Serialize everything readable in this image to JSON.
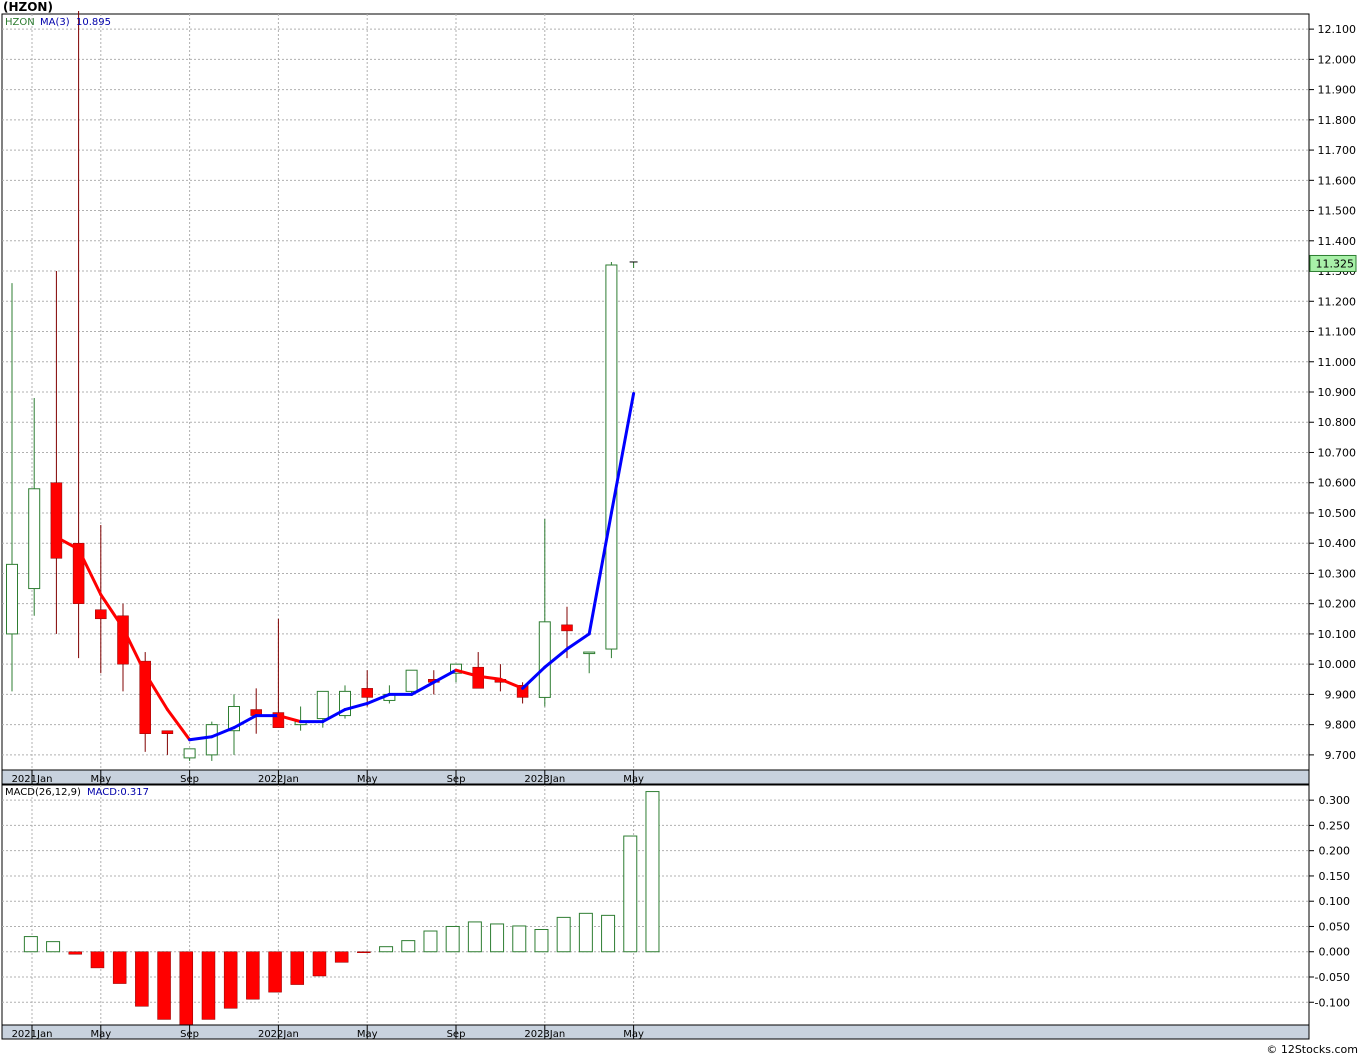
{
  "title": "(HZON)",
  "footer": "© 12Stocks.com",
  "colors": {
    "up": "#2e7d32",
    "down": "#ff0000",
    "ma_down": "#ff0000",
    "ma_up": "#0000ff",
    "axis_band": "#c8d2de",
    "grid": "#b0b0b0",
    "last_price_box": "#a8f0a8"
  },
  "x_axis": {
    "labels": [
      "2021Jan",
      "May",
      "Sep",
      "2022Jan",
      "May",
      "Sep",
      "2023Jan",
      "May"
    ],
    "label_month_index": [
      0,
      4,
      8,
      12,
      16,
      20,
      24,
      28
    ]
  },
  "price_panel": {
    "legend": {
      "symbol": "HZON",
      "ma_label": "MA(3)",
      "ma_value": "10.895"
    },
    "last_price": "11.325",
    "ylim": [
      9.65,
      12.15
    ],
    "yticks": [
      "12.100",
      "12.000",
      "11.900",
      "11.800",
      "11.700",
      "11.600",
      "11.500",
      "11.400",
      "11.300",
      "11.200",
      "11.100",
      "11.000",
      "10.900",
      "10.800",
      "10.700",
      "10.600",
      "10.500",
      "10.400",
      "10.300",
      "10.200",
      "10.100",
      "10.000",
      "9.900",
      "9.800",
      "9.700"
    ]
  },
  "macd_panel": {
    "legend": {
      "label": "MACD(26,12,9)",
      "value_label": "MACD:0.317"
    },
    "ylim": [
      -0.145,
      0.33
    ],
    "yticks": [
      "0.300",
      "0.250",
      "0.200",
      "0.150",
      "0.100",
      "0.050",
      "0.000",
      "-0.050",
      "-0.100"
    ]
  },
  "chart_data": [
    {
      "type": "candlestick",
      "title": "(HZON)",
      "x": [
        "2021-01",
        "2021-02",
        "2021-03",
        "2021-04",
        "2021-05",
        "2021-06",
        "2021-07",
        "2021-08",
        "2021-09",
        "2021-10",
        "2021-11",
        "2021-12",
        "2022-01",
        "2022-02",
        "2022-03",
        "2022-04",
        "2022-05",
        "2022-06",
        "2022-07",
        "2022-08",
        "2022-09",
        "2022-10",
        "2022-11",
        "2022-12",
        "2023-01",
        "2023-02",
        "2023-03",
        "2023-04",
        "2023-05"
      ],
      "open": [
        10.1,
        10.25,
        10.6,
        10.4,
        10.18,
        10.16,
        10.01,
        9.78,
        9.69,
        9.7,
        9.78,
        9.85,
        9.84,
        9.8,
        9.82,
        9.83,
        9.92,
        9.88,
        9.91,
        9.95,
        9.97,
        9.99,
        9.95,
        9.93,
        9.89,
        10.13,
        10.04,
        10.05,
        11.32
      ],
      "high": [
        11.26,
        10.88,
        11.3,
        12.16,
        10.46,
        10.2,
        10.04,
        9.78,
        9.72,
        9.81,
        9.9,
        9.92,
        10.15,
        9.86,
        9.85,
        9.93,
        9.98,
        9.93,
        9.98,
        9.98,
        10.0,
        10.04,
        10.0,
        9.94,
        10.48,
        10.19,
        10.04,
        11.33,
        11.33
      ],
      "low": [
        9.91,
        10.16,
        10.1,
        10.02,
        9.97,
        9.91,
        9.71,
        9.7,
        9.68,
        9.68,
        9.7,
        9.77,
        9.8,
        9.78,
        9.79,
        9.82,
        9.86,
        9.87,
        9.9,
        9.9,
        9.94,
        9.97,
        9.91,
        9.87,
        9.86,
        10.02,
        9.97,
        10.02,
        11.31
      ],
      "close": [
        10.33,
        10.58,
        10.35,
        10.2,
        10.15,
        10.0,
        9.77,
        9.77,
        9.72,
        9.8,
        9.86,
        9.83,
        9.79,
        9.81,
        9.91,
        9.91,
        9.89,
        9.9,
        9.98,
        9.94,
        10.0,
        9.92,
        9.94,
        9.89,
        10.14,
        10.11,
        10.04,
        11.32,
        11.33
      ],
      "ma3": [
        null,
        null,
        10.42,
        10.38,
        10.23,
        10.12,
        9.97,
        9.85,
        9.75,
        9.76,
        9.79,
        9.83,
        9.83,
        9.81,
        9.81,
        9.85,
        9.87,
        9.9,
        9.9,
        9.94,
        9.98,
        9.96,
        9.95,
        9.92,
        9.99,
        10.05,
        10.1,
        10.5,
        10.895
      ],
      "ylim": [
        9.65,
        12.15
      ]
    },
    {
      "type": "bar",
      "title": "MACD(26,12,9)",
      "x": [
        "2021-01",
        "2021-02",
        "2021-03",
        "2021-04",
        "2021-05",
        "2021-06",
        "2021-07",
        "2021-08",
        "2021-09",
        "2021-10",
        "2021-11",
        "2021-12",
        "2022-01",
        "2022-02",
        "2022-03",
        "2022-04",
        "2022-05",
        "2022-06",
        "2022-07",
        "2022-08",
        "2022-09",
        "2022-10",
        "2022-11",
        "2022-12",
        "2023-01",
        "2023-02",
        "2023-03",
        "2023-04",
        "2023-05"
      ],
      "values": [
        null,
        0.03,
        0.02,
        -0.005,
        -0.032,
        -0.063,
        -0.108,
        -0.134,
        -0.145,
        -0.134,
        -0.112,
        -0.094,
        -0.08,
        -0.065,
        -0.048,
        -0.021,
        -0.002,
        0.01,
        0.022,
        0.041,
        0.05,
        0.059,
        0.055,
        0.051,
        0.044,
        0.068,
        0.076,
        0.072,
        0.229,
        0.317
      ],
      "ylim": [
        -0.145,
        0.33
      ]
    }
  ]
}
